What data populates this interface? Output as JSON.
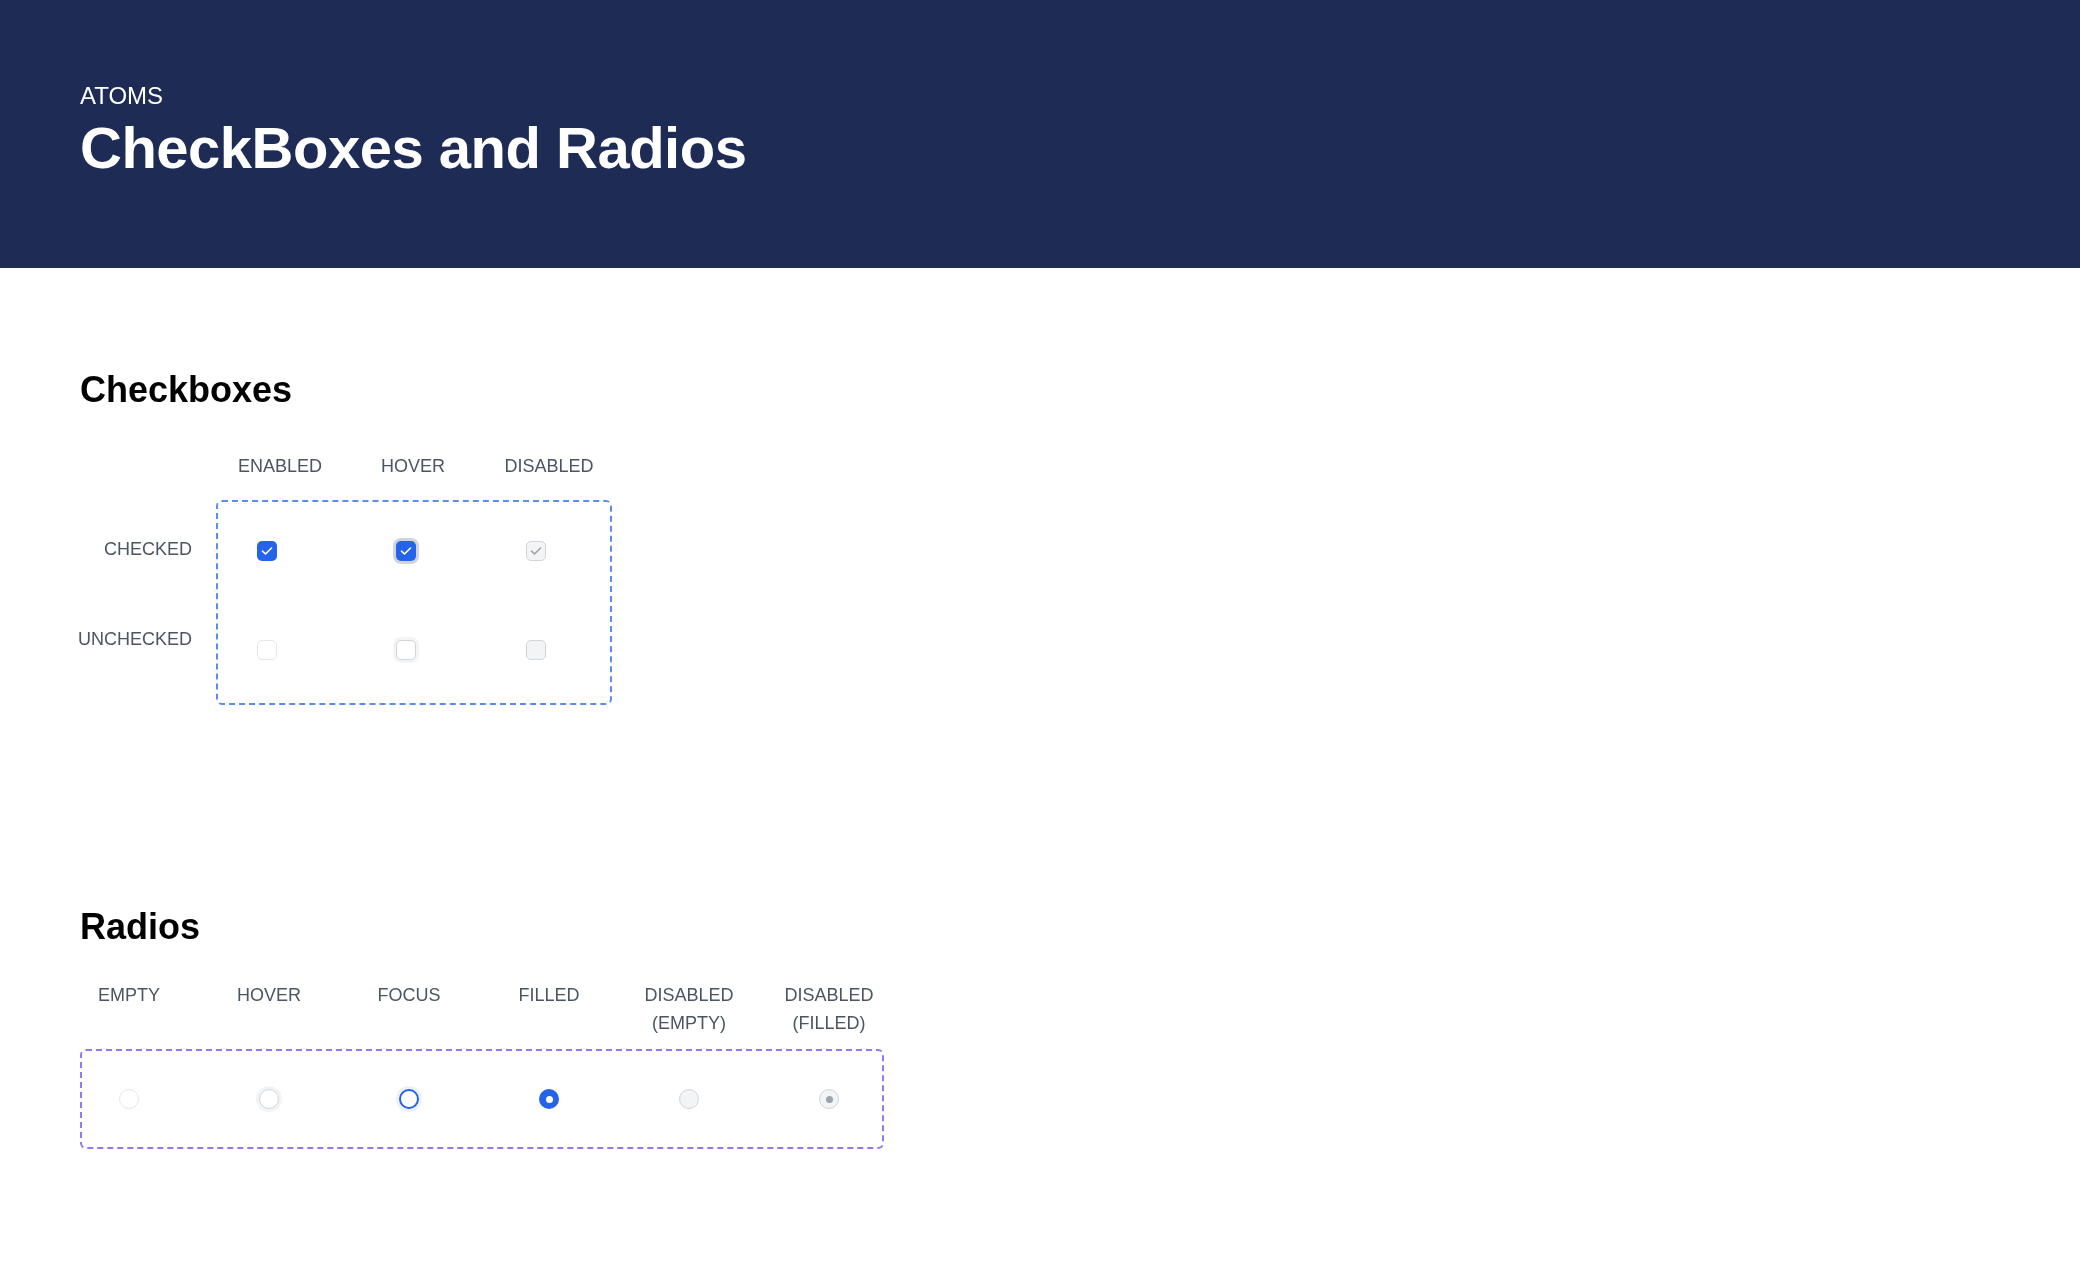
{
  "header": {
    "eyebrow": "ATOMS",
    "title": "CheckBoxes and Radios"
  },
  "checkboxes": {
    "title": "Checkboxes",
    "columns": [
      "ENABLED",
      "HOVER",
      "DISABLED"
    ],
    "rows": [
      {
        "label": "CHECKED",
        "cells": [
          {
            "kind": "enabled",
            "checked": true
          },
          {
            "kind": "hover",
            "checked": true
          },
          {
            "kind": "disabled",
            "checked": true
          }
        ]
      },
      {
        "label": "UNCHECKED",
        "cells": [
          {
            "kind": "enabled",
            "checked": false
          },
          {
            "kind": "hover",
            "checked": false
          },
          {
            "kind": "disabled",
            "checked": false
          }
        ]
      }
    ]
  },
  "radios": {
    "title": "Radios",
    "items": [
      {
        "label": "EMPTY",
        "kind": "enabled",
        "selected": false
      },
      {
        "label": "HOVER",
        "kind": "hover",
        "selected": false
      },
      {
        "label": "FOCUS",
        "kind": "focus",
        "selected": false
      },
      {
        "label": "FILLED",
        "kind": "enabled",
        "selected": true
      },
      {
        "label": "DISABLED (EMPTY)",
        "kind": "disabled",
        "selected": false
      },
      {
        "label": "DISABLED (FILLED)",
        "kind": "disabled",
        "selected": true
      }
    ]
  }
}
